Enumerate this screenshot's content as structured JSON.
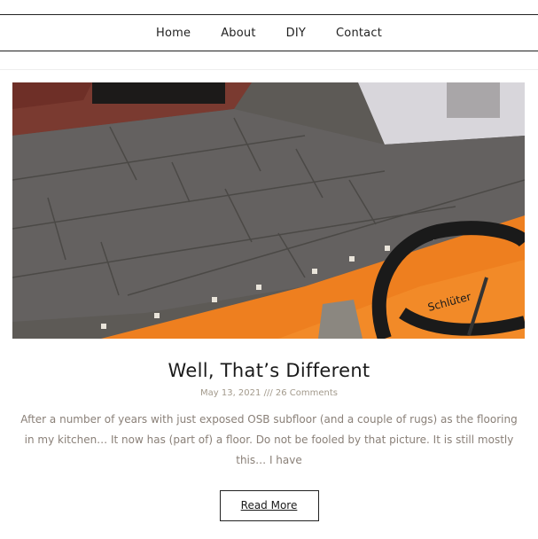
{
  "nav": {
    "items": [
      "Home",
      "About",
      "DIY",
      "Contact"
    ]
  },
  "post": {
    "title": "Well, That’s Different",
    "date": "May 13, 2021",
    "separator": "///",
    "comments": "26 Comments",
    "excerpt": "After a number of years with just exposed OSB subfloor (and a couple of rugs) as the flooring in my kitchen… It now has (part of) a floor. Do not be fooled by that picture. It is still mostly this… I have",
    "read_more_label": "Read More",
    "image_text": "Schlüter"
  }
}
